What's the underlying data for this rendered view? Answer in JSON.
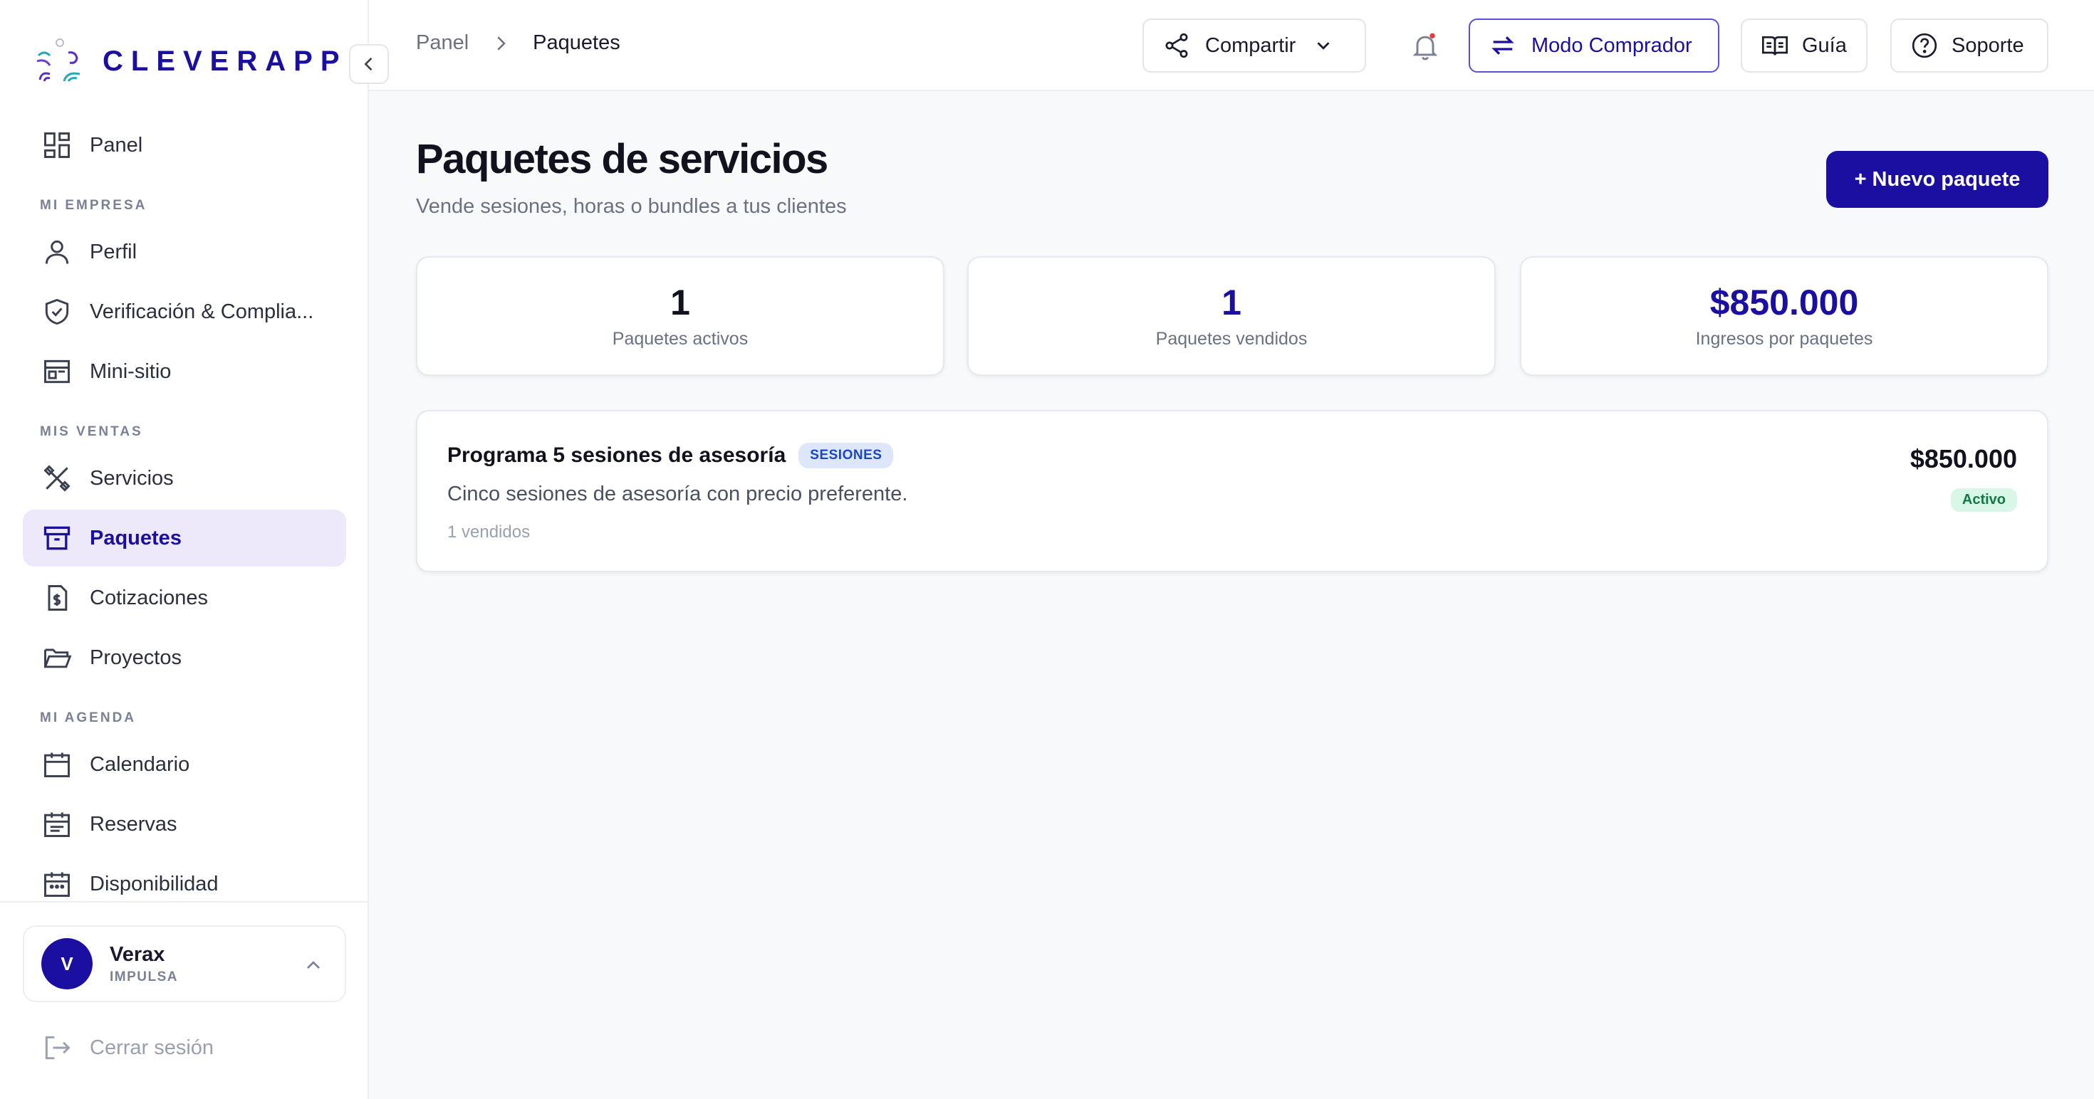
{
  "app": {
    "brand": "CLEVERAPP"
  },
  "sidebar": {
    "items": [
      {
        "label": "Panel"
      },
      {
        "section": "MI EMPRESA"
      },
      {
        "label": "Perfil"
      },
      {
        "label": "Verificación & Complia..."
      },
      {
        "label": "Mini-sitio"
      },
      {
        "section": "MIS VENTAS"
      },
      {
        "label": "Servicios"
      },
      {
        "label": "Paquetes"
      },
      {
        "label": "Cotizaciones"
      },
      {
        "label": "Proyectos"
      },
      {
        "section": "MI AGENDA"
      },
      {
        "label": "Calendario"
      },
      {
        "label": "Reservas"
      },
      {
        "label": "Disponibilidad"
      }
    ]
  },
  "user": {
    "initial": "V",
    "name": "Verax",
    "plan": "IMPULSA"
  },
  "logout": {
    "label": "Cerrar sesión"
  },
  "breadcrumb": {
    "parent": "Panel",
    "current": "Paquetes"
  },
  "topbar": {
    "share_label": "Compartir",
    "buyer_mode_label": "Modo Comprador",
    "guide_label": "Guía",
    "support_label": "Soporte"
  },
  "page": {
    "title": "Paquetes de servicios",
    "subtitle": "Vende sesiones, horas o bundles a tus clientes",
    "new_button": "+ Nuevo paquete"
  },
  "stats": [
    {
      "value": "1",
      "label": "Paquetes activos"
    },
    {
      "value": "1",
      "label": "Paquetes vendidos"
    },
    {
      "value": "$850.000",
      "label": "Ingresos por paquetes"
    }
  ],
  "packages": [
    {
      "name": "Programa 5 sesiones de asesoría",
      "type": "SESIONES",
      "description": "Cinco sesiones de asesoría con precio preferente.",
      "sold": "1 vendidos",
      "price": "$850.000",
      "status": "Activo"
    }
  ],
  "colors": {
    "brand": "#1a0fa0",
    "active_bg": "#ede9fb",
    "status_green": "#0f7a46",
    "badge_blue": "#1a45c4"
  }
}
